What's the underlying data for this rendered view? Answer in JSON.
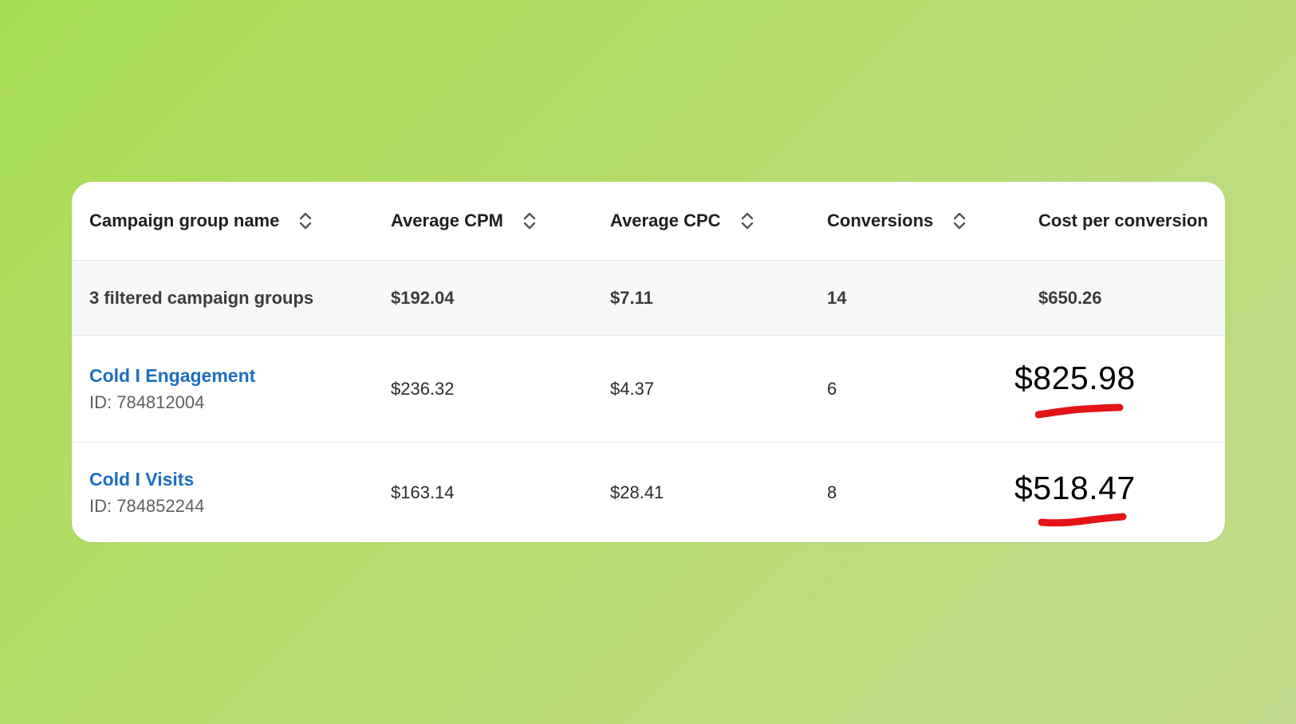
{
  "table": {
    "columns": [
      {
        "label": "Campaign group name",
        "sortable": true
      },
      {
        "label": "Average CPM",
        "sortable": true
      },
      {
        "label": "Average CPC",
        "sortable": true
      },
      {
        "label": "Conversions",
        "sortable": true
      },
      {
        "label": "Cost per conversion",
        "sortable": false
      }
    ],
    "summary": {
      "name": "3 filtered campaign groups",
      "avg_cpm": "$192.04",
      "avg_cpc": "$7.11",
      "conversions": "14",
      "cost_per_conversion": "$650.26"
    },
    "rows": [
      {
        "name": "Cold I Engagement",
        "id": "ID: 784812004",
        "avg_cpm": "$236.32",
        "avg_cpc": "$4.37",
        "conversions": "6",
        "cost_per_conversion": "$825.98"
      },
      {
        "name": "Cold I Visits",
        "id": "ID: 784852244",
        "avg_cpm": "$163.14",
        "avg_cpc": "$28.41",
        "conversions": "8",
        "cost_per_conversion": "$518.47"
      }
    ]
  },
  "colors": {
    "background_start": "#a8dd52",
    "background_end": "#c3dc8e",
    "link": "#1a6fc2",
    "annotation_underline": "#e3151a",
    "summary_row_bg": "#f6f8fa"
  },
  "icons": {
    "sort": "sort-updown-icon",
    "annotation": "red-underline-annotation"
  }
}
